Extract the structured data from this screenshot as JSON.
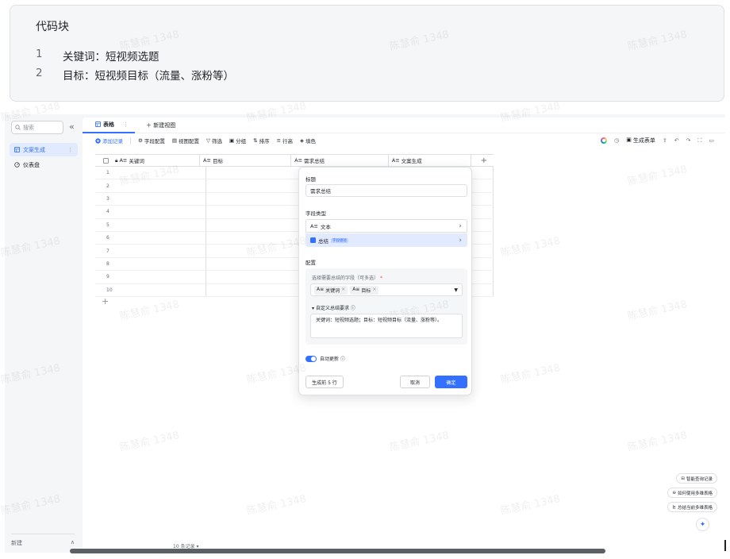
{
  "code_block": {
    "title": "代码块",
    "lines": [
      {
        "num": "1",
        "text": "关键词：短视频选题"
      },
      {
        "num": "2",
        "text": "目标：短视频目标（流量、涨粉等）"
      }
    ]
  },
  "watermark": "陈慧俞 1348",
  "sidebar": {
    "search_placeholder": "搜索",
    "collapse_icon": "«",
    "items": [
      {
        "label": "文案生成",
        "icon": "table-icon",
        "active": true
      },
      {
        "label": "仪表盘",
        "icon": "dashboard-icon",
        "active": false
      }
    ],
    "new_label": "新建",
    "expand_icon": "∧"
  },
  "view_bar": {
    "tab_label": "表格",
    "new_view_label": "新建视图"
  },
  "toolbar": {
    "add_record": "添加记录",
    "field_config": "字段配置",
    "view_config": "视图配置",
    "filter": "筛选",
    "group": "分组",
    "sort": "排序",
    "row_height": "行高",
    "fill_color": "填色",
    "generate_form": "生成表单"
  },
  "table": {
    "columns": [
      "关键词",
      "目标",
      "需求总结",
      "文案生成"
    ],
    "column_type_icon": "A≡",
    "row_numbers": [
      "1",
      "2",
      "3",
      "4",
      "5",
      "6",
      "7",
      "8",
      "9",
      "10"
    ],
    "add_row": "+",
    "add_column": "+",
    "record_count": "10 条记录"
  },
  "dialog": {
    "title_label": "标题",
    "title_value": "需求总结",
    "field_type_label": "字段类型",
    "type_text": "文本",
    "type_summary": "总结",
    "type_summary_badge": "字段捷径",
    "config_label": "配置",
    "select_fields_label": "选择需要总结的字段（可多选）",
    "required_mark": "*",
    "selected_fields": [
      "关键词",
      "目标"
    ],
    "custom_label": "自定义总结要求",
    "custom_text": "关键词：短视频选题；目标：短视频目标（流量、涨粉等）。",
    "auto_update_label": "自动更新",
    "auto_update_on": true,
    "generate_btn": "生成前 5 行",
    "cancel_btn": "取消",
    "confirm_btn": "确定"
  },
  "help_buttons": [
    "智能查询记录",
    "如何使用多维表格",
    "总结当前多维表格"
  ],
  "colors": {
    "accent": "#3370ff",
    "accent_light": "#e1eaff",
    "text": "#1f2329",
    "border": "#dee0e3"
  }
}
